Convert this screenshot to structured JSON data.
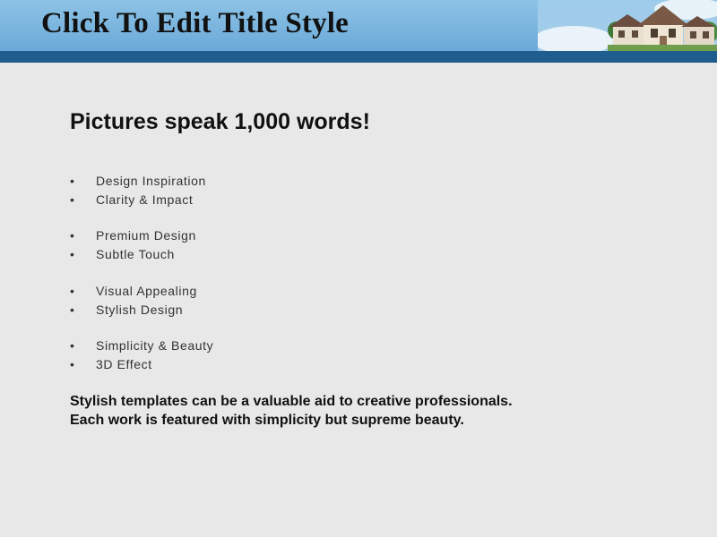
{
  "slide": {
    "title": "Click To Edit Title Style",
    "heading": "Pictures speak 1,000 words!",
    "bullet_groups": [
      [
        "Design Inspiration",
        "Clarity & Impact"
      ],
      [
        "Premium Design",
        "Subtle Touch"
      ],
      [
        "Visual Appealing",
        "Stylish Design"
      ],
      [
        "Simplicity & Beauty",
        "3D Effect"
      ]
    ],
    "footer_lines": [
      "Stylish templates can be a valuable aid to creative professionals.",
      "Each work is featured with simplicity but supreme beauty."
    ],
    "bullet_glyph": "•"
  },
  "colors": {
    "header_sky": "#8ec3e6",
    "header_band": "#1f5d8f",
    "background": "#e8e8e8"
  }
}
